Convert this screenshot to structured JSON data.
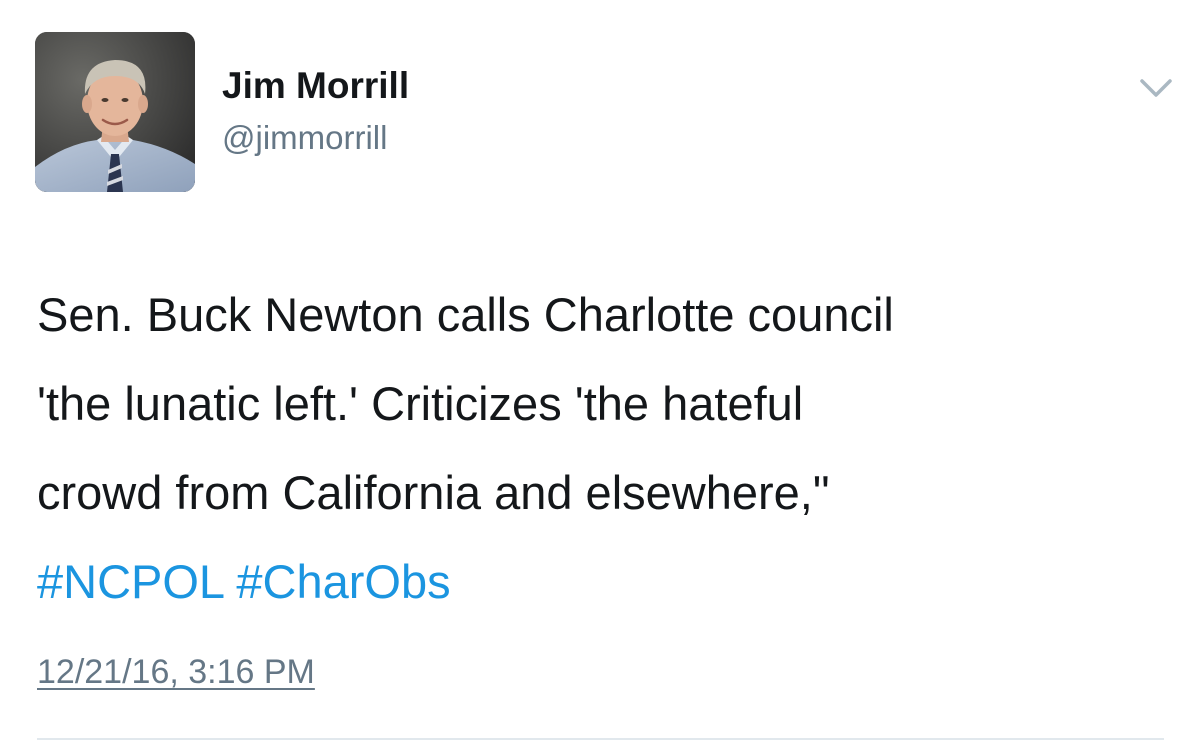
{
  "user": {
    "display_name": "Jim Morrill",
    "handle": "@jimmorrill",
    "avatar_icon": "profile-photo"
  },
  "menu": {
    "icon": "chevron-down-icon",
    "color": "#aab8c2"
  },
  "tweet": {
    "lines": [
      "Sen. Buck Newton calls Charlotte council",
      "'the lunatic left.' Criticizes 'the hateful",
      "crowd from California and elsewhere,\""
    ],
    "hashtags": [
      "#NCPOL",
      "#CharObs"
    ],
    "timestamp": "12/21/16, 3:16 PM"
  },
  "colors": {
    "text": "#14171a",
    "secondary": "#657786",
    "link": "#1b95e0",
    "divider": "#e1e8ed"
  }
}
